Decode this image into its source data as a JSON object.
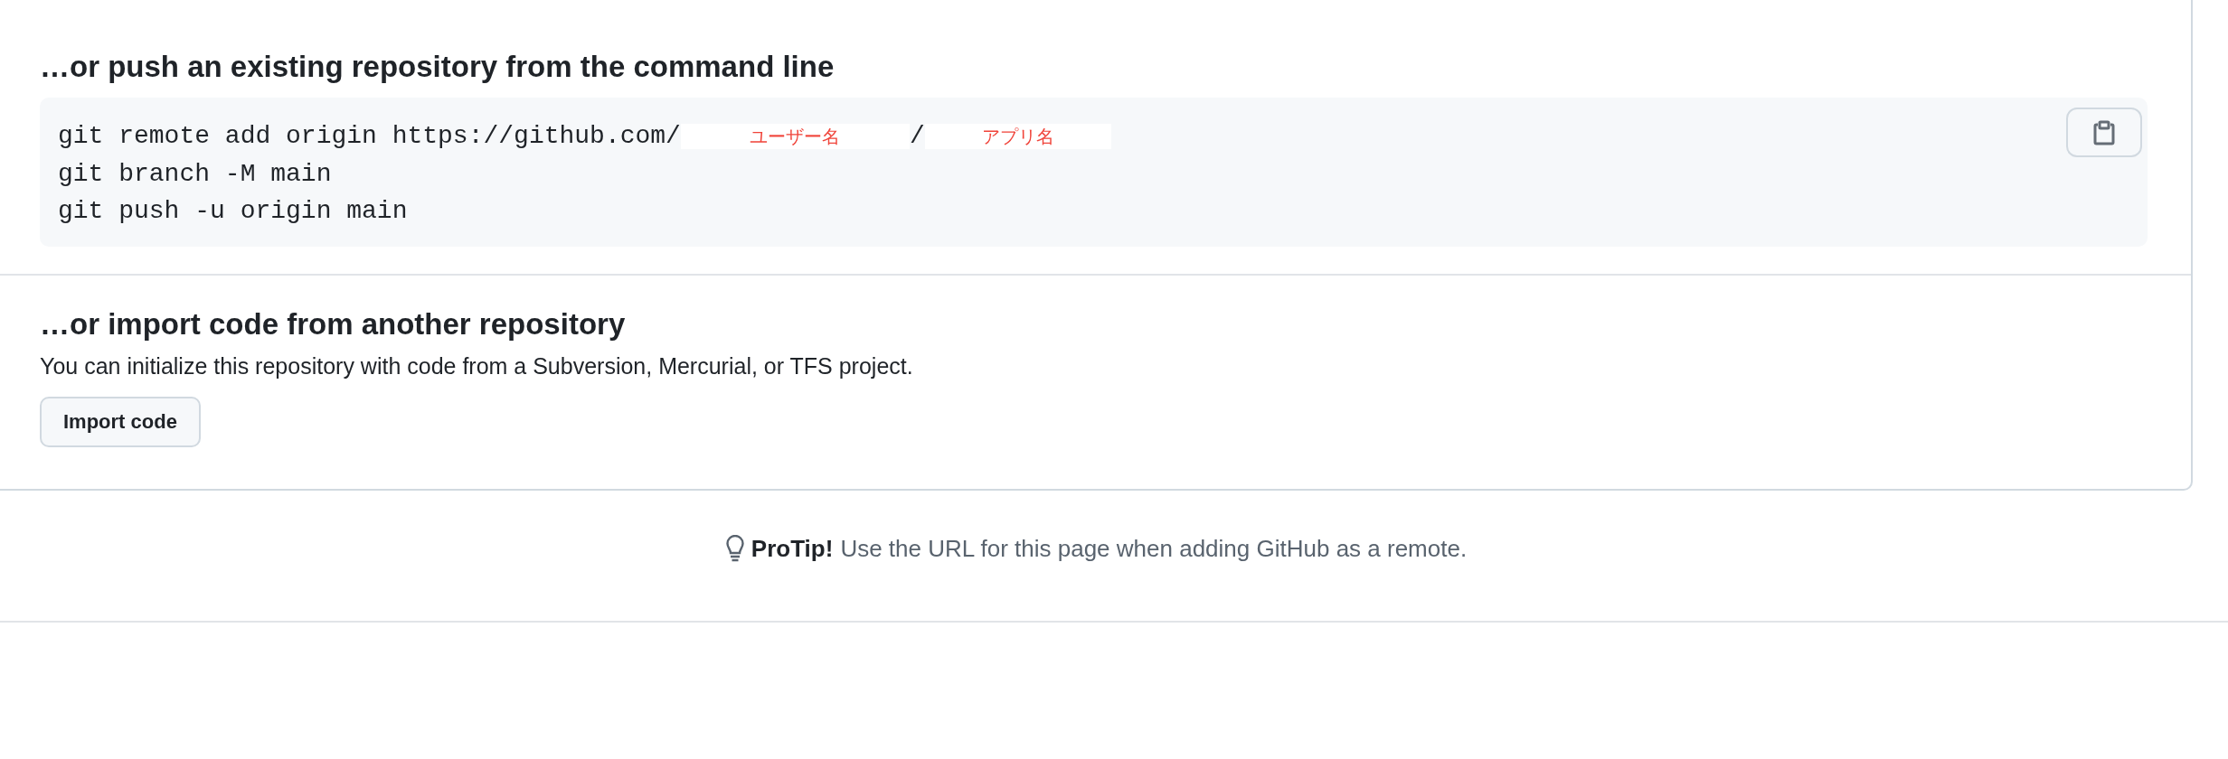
{
  "push_section": {
    "heading": "…or push an existing repository from the command line",
    "code_lines": [
      {
        "parts": [
          {
            "kind": "code",
            "text": "git remote add origin https://github.com/"
          },
          {
            "kind": "label",
            "text": "ユーザー名"
          },
          {
            "kind": "code",
            "text": "/"
          },
          {
            "kind": "label",
            "text": "アプリ名"
          }
        ]
      },
      {
        "parts": [
          {
            "kind": "code",
            "text": "git branch -M main"
          }
        ]
      },
      {
        "parts": [
          {
            "kind": "code",
            "text": "git push -u origin main"
          }
        ]
      }
    ]
  },
  "import_section": {
    "heading": "…or import code from another repository",
    "description": "You can initialize this repository with code from a Subversion, Mercurial, or TFS project.",
    "button": "Import code"
  },
  "protip": {
    "label": "ProTip!",
    "text": "Use the URL for this page when adding GitHub as a remote."
  }
}
